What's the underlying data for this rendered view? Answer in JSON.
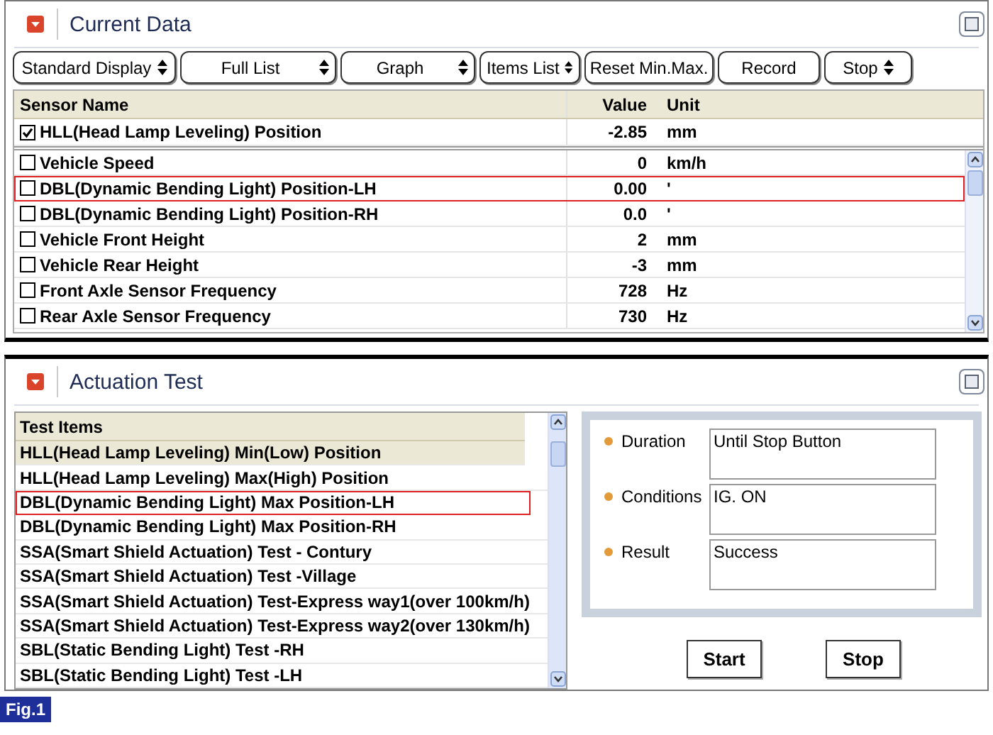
{
  "current_data": {
    "title": "Current Data",
    "toolbar": [
      {
        "label": "Standard Display",
        "dropdown": true
      },
      {
        "label": "Full List",
        "dropdown": true
      },
      {
        "label": "Graph",
        "dropdown": true
      },
      {
        "label": "Items List",
        "dropdown": true
      },
      {
        "label": "Reset Min.Max.",
        "dropdown": false
      },
      {
        "label": "Record",
        "dropdown": false
      },
      {
        "label": "Stop",
        "dropdown": true
      }
    ],
    "columns": [
      "Sensor Name",
      "Value",
      "Unit"
    ],
    "pinned_rows": [
      {
        "name": "HLL(Head Lamp Leveling) Position",
        "value": "-2.85",
        "unit": "mm",
        "checked": true,
        "outlined": false
      }
    ],
    "rows": [
      {
        "name": "Vehicle Speed",
        "value": "0",
        "unit": "km/h",
        "checked": false,
        "outlined": false
      },
      {
        "name": "DBL(Dynamic Bending Light) Position-LH",
        "value": "0.00",
        "unit": "'",
        "checked": false,
        "outlined": true
      },
      {
        "name": "DBL(Dynamic Bending Light) Position-RH",
        "value": "0.0",
        "unit": "'",
        "checked": false,
        "outlined": false
      },
      {
        "name": "Vehicle Front Height",
        "value": "2",
        "unit": "mm",
        "checked": false,
        "outlined": false
      },
      {
        "name": "Vehicle Rear Height",
        "value": "-3",
        "unit": "mm",
        "checked": false,
        "outlined": false
      },
      {
        "name": "Front Axle Sensor Frequency",
        "value": "728",
        "unit": "Hz",
        "checked": false,
        "outlined": false
      },
      {
        "name": "Rear Axle Sensor Frequency",
        "value": "730",
        "unit": "Hz",
        "checked": false,
        "outlined": false
      }
    ]
  },
  "actuation_test": {
    "title": "Actuation Test",
    "column": "Test Items",
    "items": [
      {
        "label": "HLL(Head Lamp Leveling) Min(Low) Position",
        "selected": true,
        "outlined": false
      },
      {
        "label": "HLL(Head Lamp Leveling) Max(High) Position",
        "selected": false,
        "outlined": false
      },
      {
        "label": "DBL(Dynamic Bending Light) Max Position-LH",
        "selected": false,
        "outlined": true
      },
      {
        "label": "DBL(Dynamic Bending Light) Max Position-RH",
        "selected": false,
        "outlined": false
      },
      {
        "label": "SSA(Smart Shield Actuation) Test - Contury",
        "selected": false,
        "outlined": false
      },
      {
        "label": "SSA(Smart Shield Actuation) Test -Village",
        "selected": false,
        "outlined": false
      },
      {
        "label": "SSA(Smart Shield Actuation) Test-Express way1(over 100km/h)",
        "selected": false,
        "outlined": false
      },
      {
        "label": "SSA(Smart Shield Actuation) Test-Express way2(over 130km/h)",
        "selected": false,
        "outlined": false
      },
      {
        "label": "SBL(Static Bending Light) Test -RH",
        "selected": false,
        "outlined": false
      },
      {
        "label": "SBL(Static Bending Light) Test -LH",
        "selected": false,
        "outlined": false
      }
    ],
    "details": [
      {
        "label": "Duration",
        "value": "Until Stop Button"
      },
      {
        "label": "Conditions",
        "value": "IG. ON"
      },
      {
        "label": "Result",
        "value": "Success"
      }
    ],
    "buttons": [
      "Start",
      "Stop"
    ]
  },
  "figure_label": "Fig.1"
}
